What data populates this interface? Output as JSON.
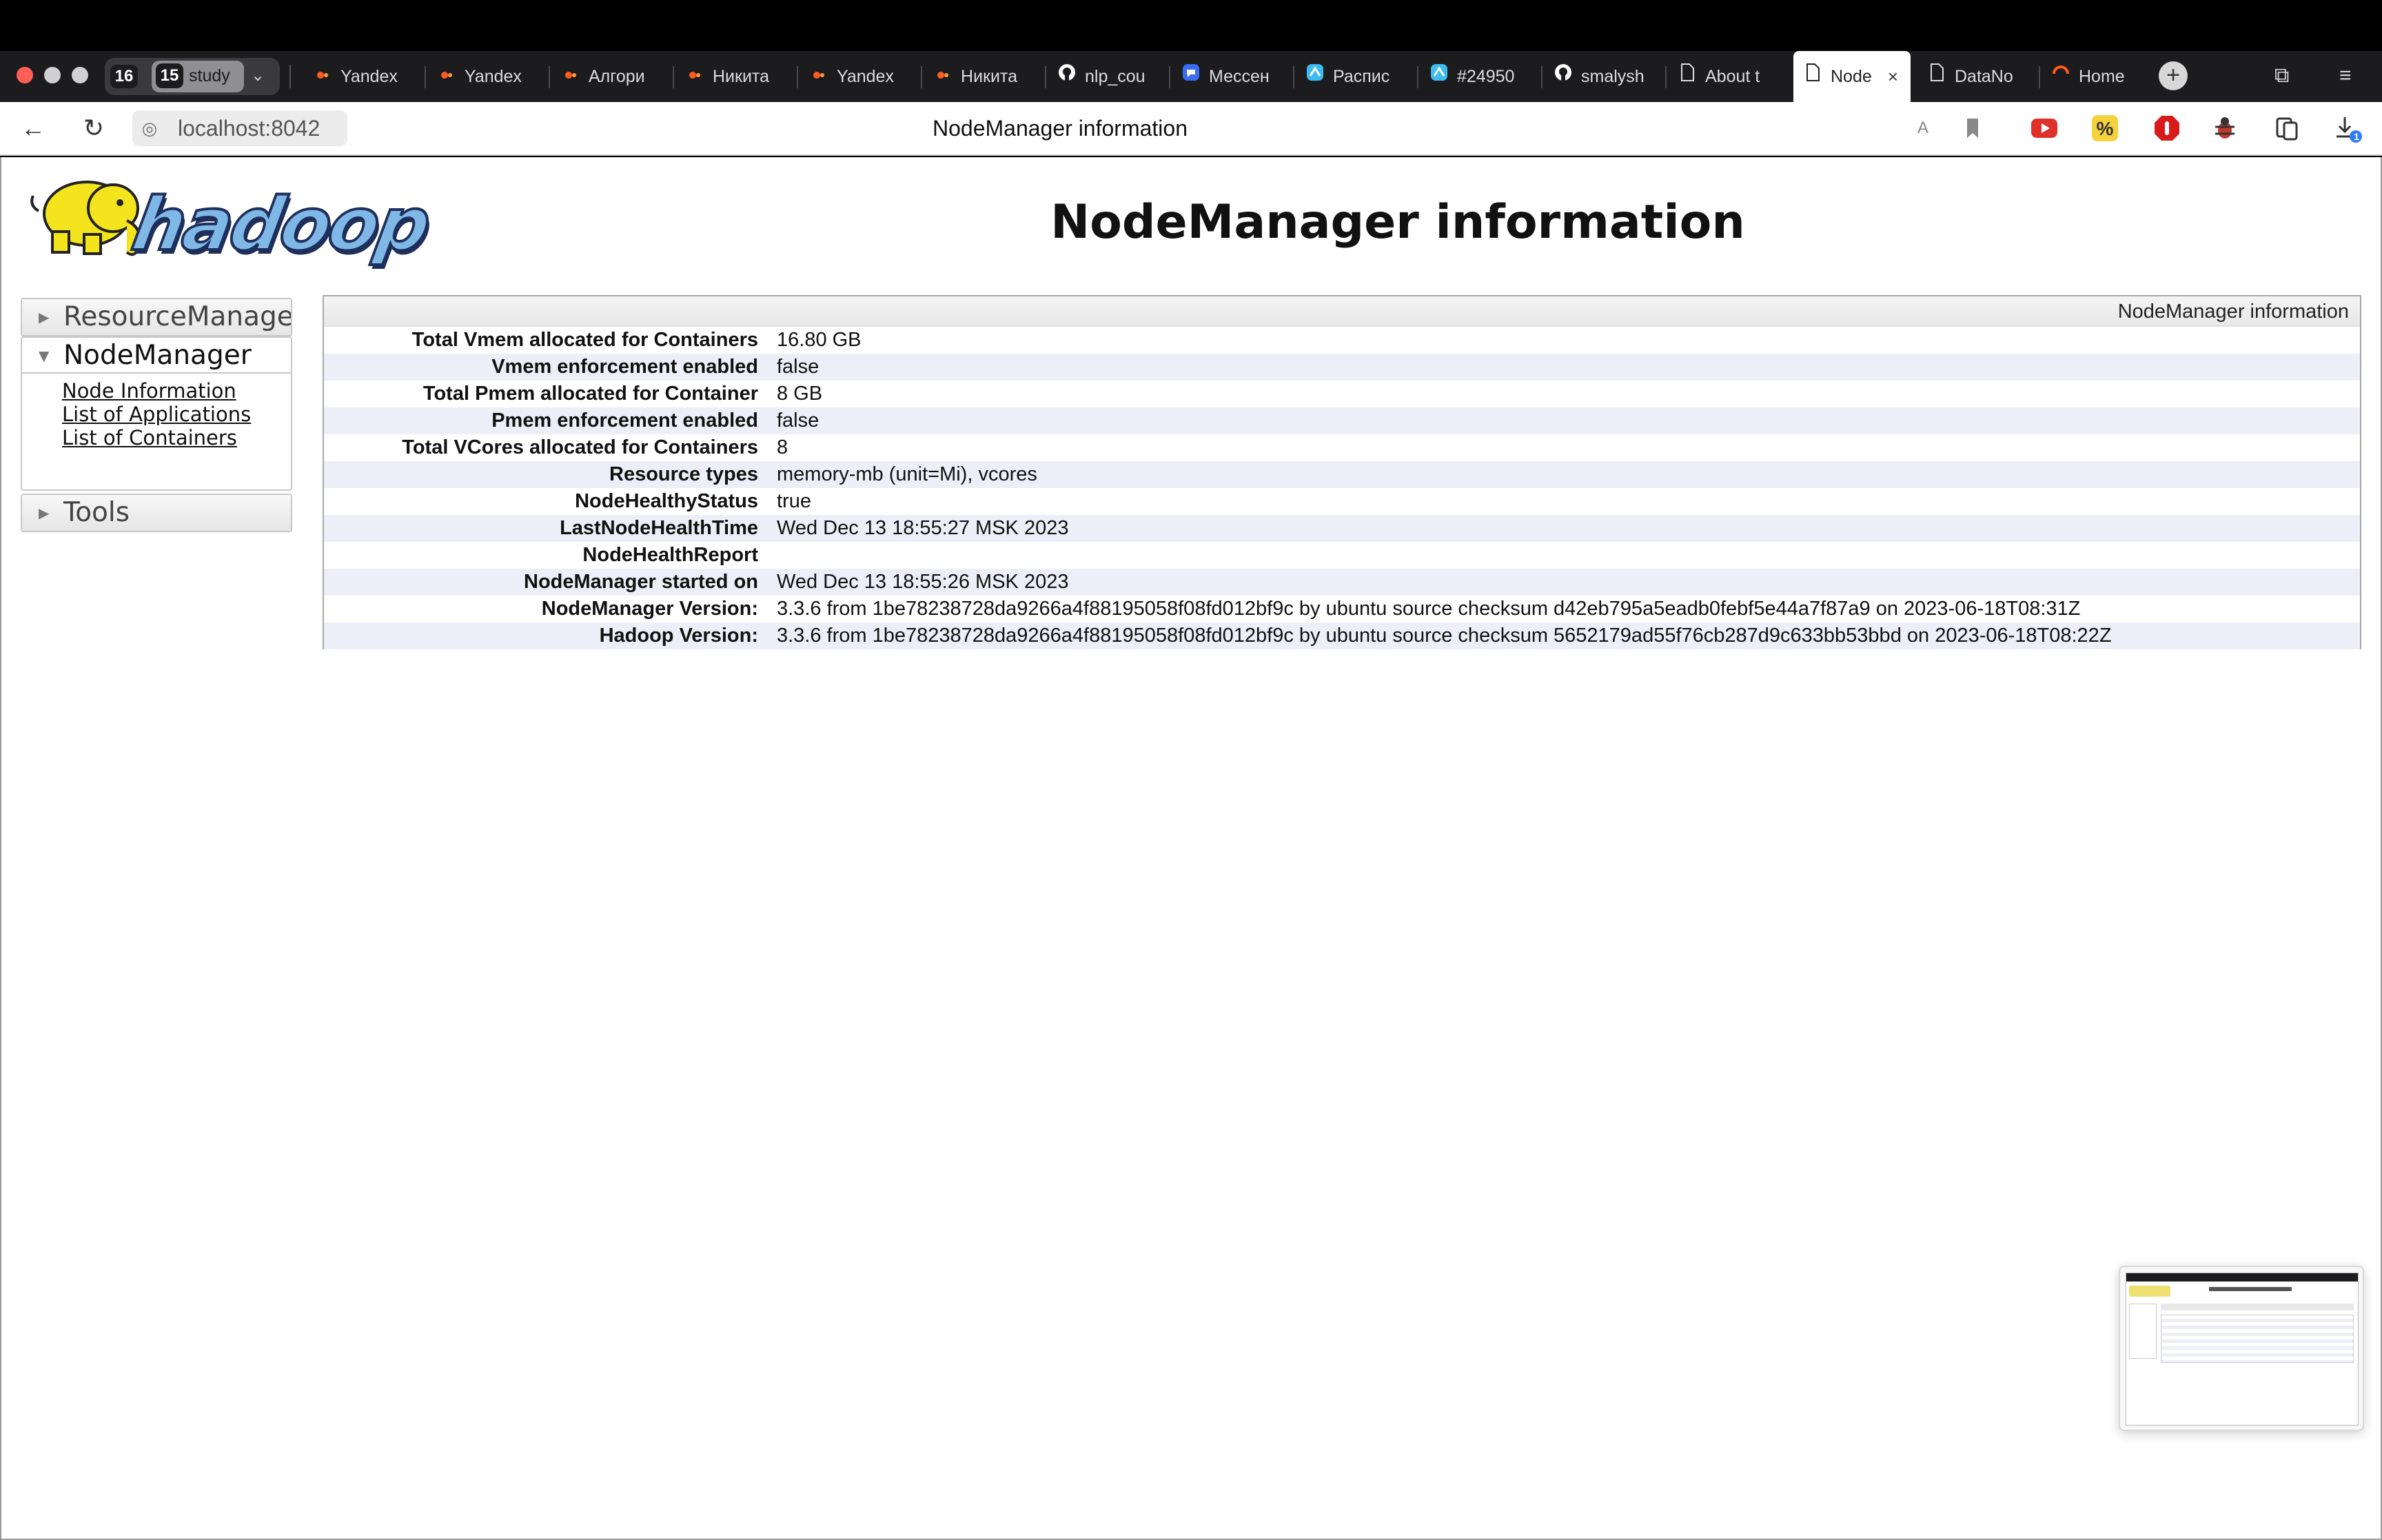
{
  "browser": {
    "workspaces": {
      "other_count": "16",
      "active_count": "15",
      "active_name": "study"
    },
    "tabs": [
      {
        "label": "Yandex",
        "icon": "yandex-icon"
      },
      {
        "label": "Yandex",
        "icon": "yandex-icon"
      },
      {
        "label": "Алгори",
        "icon": "yandex-icon"
      },
      {
        "label": "Никита",
        "icon": "yandex-icon"
      },
      {
        "label": "Yandex",
        "icon": "yandex-icon"
      },
      {
        "label": "Никита",
        "icon": "yandex-icon"
      },
      {
        "label": "nlp_cou",
        "icon": "github-icon"
      },
      {
        "label": "Мессен",
        "icon": "messenger-icon"
      },
      {
        "label": "Распис",
        "icon": "tracker-icon"
      },
      {
        "label": "#24950",
        "icon": "tracker-icon"
      },
      {
        "label": "smalysh",
        "icon": "github-icon"
      },
      {
        "label": "About t",
        "icon": "page-icon"
      },
      {
        "label": "Node",
        "icon": "page-icon",
        "active": true
      },
      {
        "label": "DataNo",
        "icon": "page-icon"
      },
      {
        "label": "Home",
        "icon": "home-ring-icon"
      }
    ],
    "address": {
      "url": "localhost:8042",
      "page_title": "NodeManager information"
    },
    "download_badge": "1",
    "colors": {
      "tab_bar": "#1c1c1e",
      "close_red": "#fe5f57",
      "row_alt": "#eeeef8"
    }
  },
  "page": {
    "logo_text": "hadoop",
    "title": "NodeManager information",
    "sidebar": {
      "resource_manager": "ResourceManager",
      "node_manager": "NodeManager",
      "node_manager_links": [
        "Node Information",
        "List of Applications",
        "List of Containers"
      ],
      "tools": "Tools"
    },
    "info": {
      "caption": "NodeManager information",
      "rows": [
        {
          "key": "Total Vmem allocated for Containers",
          "value": "16.80 GB"
        },
        {
          "key": "Vmem enforcement enabled",
          "value": "false"
        },
        {
          "key": "Total Pmem allocated for Container",
          "value": "8 GB"
        },
        {
          "key": "Pmem enforcement enabled",
          "value": "false"
        },
        {
          "key": "Total VCores allocated for Containers",
          "value": "8"
        },
        {
          "key": "Resource types",
          "value": "memory-mb (unit=Mi), vcores"
        },
        {
          "key": "NodeHealthyStatus",
          "value": "true"
        },
        {
          "key": "LastNodeHealthTime",
          "value": "Wed Dec 13 18:55:27 MSK 2023"
        },
        {
          "key": "NodeHealthReport",
          "value": ""
        },
        {
          "key": "NodeManager started on",
          "value": "Wed Dec 13 18:55:26 MSK 2023"
        },
        {
          "key": "NodeManager Version:",
          "value": "3.3.6 from 1be78238728da9266a4f88195058f08fd012bf9c by ubuntu source checksum d42eb795a5eadb0febf5e44a7f87a9 on 2023-06-18T08:31Z"
        },
        {
          "key": "Hadoop Version:",
          "value": "3.3.6 from 1be78238728da9266a4f88195058f08fd012bf9c by ubuntu source checksum 5652179ad55f76cb287d9c633bb53bbd on 2023-06-18T08:22Z"
        }
      ]
    }
  }
}
